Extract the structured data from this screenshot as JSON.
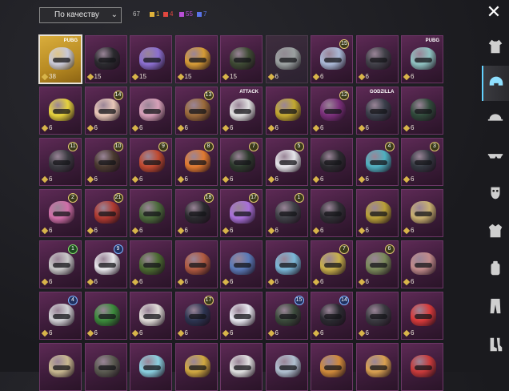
{
  "filter": {
    "sort_label": "По качеству"
  },
  "counts": {
    "total": "67",
    "stats": [
      {
        "value": "1",
        "color": "#e0b23a"
      },
      {
        "value": "4",
        "color": "#e0473f"
      },
      {
        "value": "55",
        "color": "#b94fd6"
      },
      {
        "value": "7",
        "color": "#5a74e8"
      }
    ]
  },
  "close_icon": "close-icon",
  "items": [
    {
      "lvl": "38",
      "tier": "gold",
      "color": "#c8c8d8",
      "badge": "",
      "brand": "PUBG"
    },
    {
      "lvl": "15",
      "tier": "purple",
      "color": "#2a2a2e",
      "badge": ""
    },
    {
      "lvl": "15",
      "tier": "purple",
      "color": "#8b6fd0",
      "badge": ""
    },
    {
      "lvl": "15",
      "tier": "purple",
      "color": "#d49a35",
      "badge": ""
    },
    {
      "lvl": "15",
      "tier": "purple",
      "color": "#3d4a33",
      "badge": ""
    },
    {
      "lvl": "6",
      "tier": "dim",
      "color": "#9aa0a0",
      "badge": ""
    },
    {
      "lvl": "6",
      "tier": "purple",
      "color": "#a9b8d6",
      "badge": "15",
      "btype": "gold"
    },
    {
      "lvl": "6",
      "tier": "purple",
      "color": "#404048",
      "badge": ""
    },
    {
      "lvl": "6",
      "tier": "purple",
      "color": "#8ec1c0",
      "badge": "",
      "brand": "PUBG"
    },
    {
      "lvl": "6",
      "tier": "purple",
      "color": "#e6d23c",
      "badge": ""
    },
    {
      "lvl": "6",
      "tier": "purple",
      "color": "#e9c8b8",
      "badge": "14",
      "btype": "gold"
    },
    {
      "lvl": "6",
      "tier": "purple",
      "color": "#d7a0b8",
      "badge": ""
    },
    {
      "lvl": "6",
      "tier": "purple",
      "color": "#9a6a3a",
      "badge": "13",
      "btype": "gold"
    },
    {
      "lvl": "6",
      "tier": "purple",
      "color": "#e0e0e0",
      "badge": "",
      "brand": "ATTACK"
    },
    {
      "lvl": "6",
      "tier": "purple",
      "color": "#c2a830",
      "badge": ""
    },
    {
      "lvl": "6",
      "tier": "purple",
      "color": "#7a2f7a",
      "badge": "12",
      "btype": "gold"
    },
    {
      "lvl": "6",
      "tier": "purple",
      "color": "#3a3f4a",
      "badge": "",
      "brand": "GODZILLA"
    },
    {
      "lvl": "6",
      "tier": "purple",
      "color": "#2f4a3a",
      "badge": ""
    },
    {
      "lvl": "6",
      "tier": "purple",
      "color": "#3a3a40",
      "badge": "11",
      "btype": "gold"
    },
    {
      "lvl": "6",
      "tier": "purple",
      "color": "#4a3a30",
      "badge": "10",
      "btype": "gold"
    },
    {
      "lvl": "6",
      "tier": "purple",
      "color": "#c04a30",
      "badge": "9",
      "btype": "gold"
    },
    {
      "lvl": "6",
      "tier": "purple",
      "color": "#e07a30",
      "badge": "8",
      "btype": "gold"
    },
    {
      "lvl": "6",
      "tier": "purple",
      "color": "#2c3a2c",
      "badge": "7",
      "btype": "gold"
    },
    {
      "lvl": "6",
      "tier": "purple",
      "color": "#e6e6ea",
      "badge": "5",
      "btype": "gold"
    },
    {
      "lvl": "6",
      "tier": "purple",
      "color": "#2a2a2e",
      "badge": ""
    },
    {
      "lvl": "6",
      "tier": "purple",
      "color": "#4fb0c0",
      "badge": "4",
      "btype": "gold"
    },
    {
      "lvl": "6",
      "tier": "purple",
      "color": "#333840",
      "badge": "3",
      "btype": "gold"
    },
    {
      "lvl": "6",
      "tier": "purple",
      "color": "#d06fa8",
      "badge": "2",
      "btype": "gold"
    },
    {
      "lvl": "6",
      "tier": "purple",
      "color": "#b03a30",
      "badge": "21",
      "btype": "gold"
    },
    {
      "lvl": "6",
      "tier": "purple",
      "color": "#4a6a3a",
      "badge": ""
    },
    {
      "lvl": "6",
      "tier": "purple",
      "color": "#2a2a2e",
      "badge": "18",
      "btype": "gold"
    },
    {
      "lvl": "6",
      "tier": "purple",
      "color": "#a870d8",
      "badge": "17",
      "btype": "gold"
    },
    {
      "lvl": "6",
      "tier": "purple",
      "color": "#3e4046",
      "badge": "1",
      "btype": "gold"
    },
    {
      "lvl": "6",
      "tier": "purple",
      "color": "#2e2e33",
      "badge": ""
    },
    {
      "lvl": "6",
      "tier": "purple",
      "color": "#b8a038",
      "badge": ""
    },
    {
      "lvl": "6",
      "tier": "purple",
      "color": "#c8b070",
      "badge": ""
    },
    {
      "lvl": "6",
      "tier": "purple",
      "color": "#c8c8c8",
      "badge": "1",
      "btype": "green"
    },
    {
      "lvl": "6",
      "tier": "purple",
      "color": "#e8e8ec",
      "badge": "9",
      "btype": "blue"
    },
    {
      "lvl": "6",
      "tier": "purple",
      "color": "#4a6a30",
      "badge": ""
    },
    {
      "lvl": "6",
      "tier": "purple",
      "color": "#b05a40",
      "badge": ""
    },
    {
      "lvl": "6",
      "tier": "purple",
      "color": "#5a7ab8",
      "badge": ""
    },
    {
      "lvl": "6",
      "tier": "purple",
      "color": "#7ab8d8",
      "badge": ""
    },
    {
      "lvl": "6",
      "tier": "purple",
      "color": "#c8b04a",
      "badge": "7",
      "btype": "gold"
    },
    {
      "lvl": "6",
      "tier": "purple",
      "color": "#7a8a5a",
      "badge": "6",
      "btype": "gold"
    },
    {
      "lvl": "6",
      "tier": "purple",
      "color": "#c08a8a",
      "badge": ""
    },
    {
      "lvl": "6",
      "tier": "purple",
      "color": "#d0d0d4",
      "badge": "4",
      "btype": "blue"
    },
    {
      "lvl": "6",
      "tier": "purple",
      "color": "#3a8a3a",
      "badge": ""
    },
    {
      "lvl": "6",
      "tier": "purple",
      "color": "#e0dcd8",
      "badge": ""
    },
    {
      "lvl": "6",
      "tier": "purple",
      "color": "#2c3450",
      "badge": "17",
      "btype": "gold"
    },
    {
      "lvl": "6",
      "tier": "purple",
      "color": "#e8e8f0",
      "badge": ""
    },
    {
      "lvl": "6",
      "tier": "purple",
      "color": "#3a4a3a",
      "badge": "15",
      "btype": "blue"
    },
    {
      "lvl": "6",
      "tier": "purple",
      "color": "#2a2a30",
      "badge": "14",
      "btype": "blue"
    },
    {
      "lvl": "6",
      "tier": "purple",
      "color": "#3a3a40",
      "badge": ""
    },
    {
      "lvl": "6",
      "tier": "purple",
      "color": "#d83a3a",
      "badge": ""
    },
    {
      "lvl": "",
      "tier": "purple",
      "color": "#c8b890",
      "badge": ""
    },
    {
      "lvl": "",
      "tier": "purple",
      "color": "#5a5a50",
      "badge": ""
    },
    {
      "lvl": "",
      "tier": "purple",
      "color": "#8ad0e0",
      "badge": ""
    },
    {
      "lvl": "",
      "tier": "purple",
      "color": "#d0a840",
      "badge": ""
    },
    {
      "lvl": "",
      "tier": "purple",
      "color": "#e0e0e0",
      "badge": ""
    },
    {
      "lvl": "",
      "tier": "purple",
      "color": "#b0c0d0",
      "badge": ""
    },
    {
      "lvl": "",
      "tier": "purple",
      "color": "#d08a3a",
      "badge": ""
    },
    {
      "lvl": "",
      "tier": "purple",
      "color": "#d8a050",
      "badge": ""
    },
    {
      "lvl": "",
      "tier": "purple",
      "color": "#c83a3a",
      "badge": ""
    }
  ],
  "sidebar": [
    {
      "icon": "outfit-icon",
      "active": false
    },
    {
      "icon": "helmet-icon",
      "active": true
    },
    {
      "icon": "cap-icon",
      "active": false
    },
    {
      "icon": "glasses-icon",
      "active": false
    },
    {
      "icon": "mask-icon",
      "active": false
    },
    {
      "icon": "jacket-icon",
      "active": false
    },
    {
      "icon": "backpack-icon",
      "active": false
    },
    {
      "icon": "pants-icon",
      "active": false
    },
    {
      "icon": "boots-icon",
      "active": false
    }
  ]
}
